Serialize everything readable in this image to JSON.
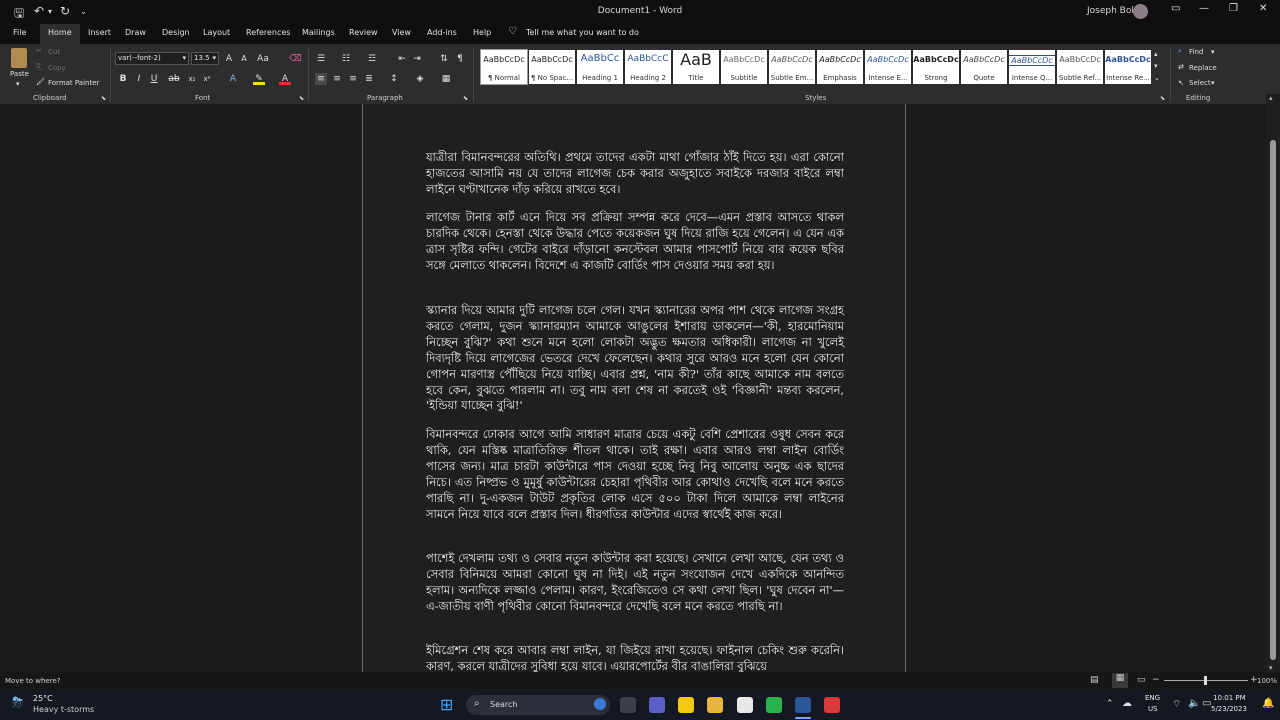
{
  "window": {
    "doc_title": "Document1 - Word",
    "user": "Joseph Bolt"
  },
  "tabs": [
    "File",
    "Home",
    "Insert",
    "Draw",
    "Design",
    "Layout",
    "References",
    "Mailings",
    "Review",
    "View",
    "Add-ins",
    "Help"
  ],
  "tell_me": "Tell me what you want to do",
  "ribbon": {
    "clipboard": {
      "paste": "Paste",
      "cut": "Cut",
      "copy": "Copy",
      "format_painter": "Format Painter",
      "label": "Clipboard"
    },
    "font": {
      "name": "var(--font-2)",
      "size": "13.5",
      "label": "Font"
    },
    "paragraph": {
      "label": "Paragraph"
    },
    "styles": {
      "label": "Styles",
      "items": [
        {
          "sample": "AaBbCcDc",
          "name": "¶ Normal"
        },
        {
          "sample": "AaBbCcDc",
          "name": "¶ No Spac..."
        },
        {
          "sample": "AaBbCc",
          "name": "Heading 1"
        },
        {
          "sample": "AaBbCcC",
          "name": "Heading 2"
        },
        {
          "sample": "AaB",
          "name": "Title"
        },
        {
          "sample": "AaBbCcDc",
          "name": "Subtitle"
        },
        {
          "sample": "AaBbCcDc",
          "name": "Subtle Em..."
        },
        {
          "sample": "AaBbCcDc",
          "name": "Emphasis"
        },
        {
          "sample": "AaBbCcDc",
          "name": "Intense E..."
        },
        {
          "sample": "AaBbCcDc",
          "name": "Strong"
        },
        {
          "sample": "AaBbCcDc",
          "name": "Quote"
        },
        {
          "sample": "AaBbCcDc",
          "name": "Intense Q..."
        },
        {
          "sample": "AaBbCcDc",
          "name": "Subtle Ref..."
        },
        {
          "sample": "AaBbCcDc",
          "name": "Intense Re..."
        }
      ]
    },
    "editing": {
      "find": "Find",
      "replace": "Replace",
      "select": "Select",
      "label": "Editing"
    }
  },
  "document": {
    "paragraphs": [
      "যাত্রীরা বিমানবন্দরের অতিথি। প্রথমে তাদের একটা মাথা গোঁজার ঠাঁই দিতে হয়। এরা কোনো হাজতের আসামি নয় যে তাদের লাগেজ চেক করার অজুহাতে সবাইকে দরজার বাইরে লম্বা লাইনে ঘণ্টাখানেক দাঁড় করিয়ে রাখতে হবে।",
      "লাগেজ টানার কার্ট এনে দিয়ে সব প্রক্রিয়া সম্পন্ন করে দেবে—এমন প্রস্তাব আসতে থাকল চারদিক থেকে। হেনস্তা থেকে উদ্ধার পেতে কয়েকজন ঘুষ দিয়ে রাজি হয়ে গেলেন। এ যেন এক ত্রাস সৃষ্টির ফন্দি। গেটের বাইরে দাঁড়ানো কনস্টেবল আমার পাসপোর্ট নিয়ে বার কয়েক ছবির সঙ্গে মেলাতে থাকলেন। বিদেশে এ কাজটি বোর্ডিং পাস দেওয়ার সময় করা হয়।",
      "স্ক্যানার দিয়ে আমার দুটি লাগেজ চলে গেল। যখন স্ক্যানারের অপর পাশ থেকে লাগেজ সংগ্রহ করতে গেলাম, দুজন স্ক্যানারম্যান আমাকে আঙুলের ইশারায় ডাকলেন—'কী, হারমোনিয়াম নিচ্ছেন বুঝি?' কথা শুনে মনে হলো লোকটা অদ্ভুত ক্ষমতার অধিকারী। লাগেজ না খুলেই দিব্যদৃষ্টি দিয়ে লাগেজের ভেতরে দেখে ফেলেছেন। কথার সুরে আরও মনে হলো যেন কোনো গোপন মারণাস্ত্র পৌঁছিয়ে নিয়ে যাচ্ছি। এবার প্রশ্ন, 'নাম কী?' তাঁর কাছে আমাকে নাম বলতে হবে কেন, বুঝতে পারলাম না। তবু নাম বলা শেষ না করতেই ওই 'বিজ্ঞানী' মন্তব্য করলেন, 'ইন্ডিয়া যাচ্ছেন বুঝি!'",
      "বিমানবন্দরে ঢোকার আগে আমি সাধারণ মাত্রার চেয়ে একটু বেশি প্রেশারের ওষুধ সেবন করে থাকি, যেন মস্তিষ্ক মাত্রাতিরিক্ত শীতল থাকে। তাই রক্ষা। এবার আরও লম্বা লাইন বোর্ডিং পাসের জন্য। মাত্র চারটা কাউন্টারে পাস দেওয়া হচ্ছে নিবু নিবু আলোয় অনুচ্চ এক ছাদের নিচে। এত নিষ্প্রভ ও মুমূর্ষু কাউন্টারের চেহারা পৃথিবীর আর কোথাও দেখেছি বলে মনে করতে পারছি না। দু-একজন টাউট প্রকৃতির লোক এসে ৫০০ টাকা দিলে আমাকে লম্বা লাইনের সামনে নিয়ে যাবে বলে প্রস্তাব দিল। ধীরগতির কাউন্টার এদের স্বার্থেই কাজ করে।",
      "পাশেই দেখলাম তথ্য ও সেবার নতুন কাউন্টার করা হয়েছে। সেখানে লেখা আছে, যেন তথ্য ও সেবার বিনিময়ে আমরা কোনো ঘুষ না দিই। এই নতুন সংযোজন দেখে একদিকে আনন্দিত হলাম। অন্যদিকে লজ্জাও পেলাম। কারণ, ইংরেজিতেও সে কথা লেখা ছিল। 'ঘুষ দেবেন না'—এ-জাতীয় বাণী পৃথিবীর কোনো বিমানবন্দরে দেখেছি বলে মনে করতে পারছি না।",
      "ইমিগ্রেশন শেষ করে আবার লম্বা লাইন, যা জিইয়ে রাখা হয়েছে। ফাইনাল চেকিং শুরু করেনি। কারণ, করলে যাত্রীদের সুবিধা হয়ে যাবে। এয়ারপোর্টের বীর বাঙালিরা বুঝিয়ে"
    ]
  },
  "status": {
    "left": "Move to where?",
    "zoom": "100%"
  },
  "taskbar": {
    "weather_temp": "25°C",
    "weather_desc": "Heavy t-storms",
    "search": "Search",
    "lang1": "ENG",
    "lang2": "US",
    "time": "10:01 PM",
    "date": "5/23/2023"
  }
}
